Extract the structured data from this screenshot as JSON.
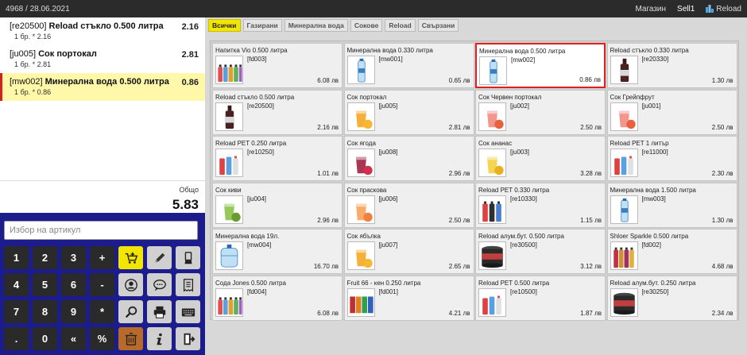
{
  "topbar": {
    "order_info": "4968 / 28.06.2021",
    "shop": "Магазин",
    "user": "Sell1",
    "reload": "Reload"
  },
  "order": {
    "lines": [
      {
        "code": "[re20500]",
        "name": "Reload стъкло 0.500 литра",
        "qty": "1 бр. * 2.16",
        "total": "2.16",
        "selected": false
      },
      {
        "code": "[ju005]",
        "name": "Сок портокал",
        "qty": "1 бр. * 2.81",
        "total": "2.81",
        "selected": false
      },
      {
        "code": "[mw002]",
        "name": "Минерална вода 0.500 литра",
        "qty": "1 бр. * 0.86",
        "total": "0.86",
        "selected": true
      }
    ],
    "total_label": "Общо",
    "total_value": "5.83"
  },
  "search": {
    "placeholder": "Избор на артикул"
  },
  "keypad": [
    {
      "label": "1",
      "type": "num"
    },
    {
      "label": "2",
      "type": "num"
    },
    {
      "label": "3",
      "type": "num"
    },
    {
      "label": "+",
      "type": "num"
    },
    {
      "icon": "add-to-cart-icon",
      "type": "icon",
      "color": "#f2e600"
    },
    {
      "icon": "pencil-icon",
      "type": "icon"
    },
    {
      "icon": "hand-card-icon",
      "type": "icon"
    },
    {
      "label": "4",
      "type": "num"
    },
    {
      "label": "5",
      "type": "num"
    },
    {
      "label": "6",
      "type": "num"
    },
    {
      "label": "-",
      "type": "num"
    },
    {
      "icon": "customer-icon",
      "type": "icon"
    },
    {
      "icon": "chat-icon",
      "type": "icon"
    },
    {
      "icon": "receipt-icon",
      "type": "icon"
    },
    {
      "label": "7",
      "type": "num"
    },
    {
      "label": "8",
      "type": "num"
    },
    {
      "label": "9",
      "type": "num"
    },
    {
      "label": "*",
      "type": "num"
    },
    {
      "icon": "search-icon",
      "type": "icon"
    },
    {
      "icon": "printer-icon",
      "type": "icon"
    },
    {
      "icon": "keyboard-icon",
      "type": "icon"
    },
    {
      "label": ".",
      "type": "num"
    },
    {
      "label": "0",
      "type": "num"
    },
    {
      "label": "«",
      "type": "num"
    },
    {
      "label": "%",
      "type": "num"
    },
    {
      "icon": "trash-icon",
      "type": "icon",
      "color": "#b86a2a"
    },
    {
      "icon": "info-icon",
      "type": "icon"
    },
    {
      "icon": "logout-icon",
      "type": "icon"
    }
  ],
  "tabs": [
    {
      "label": "Всички",
      "active": true
    },
    {
      "label": "Газирани",
      "active": false
    },
    {
      "label": "Минерална вода",
      "active": false
    },
    {
      "label": "Сокове",
      "active": false
    },
    {
      "label": "Reload",
      "active": false
    },
    {
      "label": "Свързани",
      "active": false
    }
  ],
  "products": [
    {
      "name": "Напитка Vio 0.500 литра",
      "code": "[fd003]",
      "price": "6.08 лв",
      "thumb": "multi-bottles",
      "selected": false
    },
    {
      "name": "Минерална вода 0.330 литра",
      "code": "[mw001]",
      "price": "0.65 лв",
      "thumb": "water",
      "selected": false
    },
    {
      "name": "Минерална вода 0.500 литра",
      "code": "[mw002]",
      "price": "0.86 лв",
      "thumb": "water",
      "selected": true
    },
    {
      "name": "Reload стъкло 0.330 литра",
      "code": "[re20330]",
      "price": "1.30 лв",
      "thumb": "reload-glass",
      "selected": false
    },
    {
      "name": "Reload стъкло 0.500 литра",
      "code": "[re20500]",
      "price": "2.16 лв",
      "thumb": "reload-glass",
      "selected": false
    },
    {
      "name": "Сок портокал",
      "code": "[ju005]",
      "price": "2.81 лв",
      "thumb": "juice-orange",
      "selected": false
    },
    {
      "name": "Сок Червен портокал",
      "code": "[ju002]",
      "price": "2.50 лв",
      "thumb": "juice-grapefruit",
      "selected": false
    },
    {
      "name": "Сок Грейпфрут",
      "code": "[ju001]",
      "price": "2.50 лв",
      "thumb": "juice-grapefruit",
      "selected": false
    },
    {
      "name": "Reload PET 0.250 литра",
      "code": "[re10250]",
      "price": "1.01 лв",
      "thumb": "reload-pet",
      "selected": false
    },
    {
      "name": "Сок ягода",
      "code": "[ju008]",
      "price": "2.96 лв",
      "thumb": "juice-red",
      "selected": false
    },
    {
      "name": "Сок ананас",
      "code": "[ju003]",
      "price": "3.28 лв",
      "thumb": "juice-pineapple",
      "selected": false
    },
    {
      "name": "Reload PET 1 литър",
      "code": "[re11000]",
      "price": "2.30 лв",
      "thumb": "reload-pet",
      "selected": false
    },
    {
      "name": "Сок киви",
      "code": "[ju004]",
      "price": "2.96 лв",
      "thumb": "juice-kiwi",
      "selected": false
    },
    {
      "name": "Сок праскова",
      "code": "[ju006]",
      "price": "2.50 лв",
      "thumb": "juice-peach",
      "selected": false
    },
    {
      "name": "Reload PET 0.330 литра",
      "code": "[re10330]",
      "price": "1.15 лв",
      "thumb": "reload-dark",
      "selected": false
    },
    {
      "name": "Минерална вода 1.500 литра",
      "code": "[mw003]",
      "price": "1.30 лв",
      "thumb": "water",
      "selected": false
    },
    {
      "name": "Минерална вода 19л.",
      "code": "[mw004]",
      "price": "16.70 лв",
      "thumb": "water-jug",
      "selected": false
    },
    {
      "name": "Сок ябълка",
      "code": "[ju007]",
      "price": "2.65 лв",
      "thumb": "juice-orange",
      "selected": false
    },
    {
      "name": "Reload алум.бут. 0.500 литра",
      "code": "[re30500]",
      "price": "3.12 лв",
      "thumb": "reload-can",
      "selected": false
    },
    {
      "name": "Shloer Sparkle 0.500 литра",
      "code": "[fd002]",
      "price": "4.68 лв",
      "thumb": "shloer",
      "selected": false
    },
    {
      "name": "Сода Jones 0.500 литра",
      "code": "[fd004]",
      "price": "6.08 лв",
      "thumb": "multi-bottles",
      "selected": false
    },
    {
      "name": "Fruit 66 - кен 0.250 литра",
      "code": "[fd001]",
      "price": "4.21 лв",
      "thumb": "cans",
      "selected": false
    },
    {
      "name": "Reload PET 0.500 литра",
      "code": "[re10500]",
      "price": "1.87 лв",
      "thumb": "reload-pet",
      "selected": false
    },
    {
      "name": "Reload алум.бут. 0.250 литра",
      "code": "[re30250]",
      "price": "2.34 лв",
      "thumb": "reload-can",
      "selected": false
    }
  ]
}
